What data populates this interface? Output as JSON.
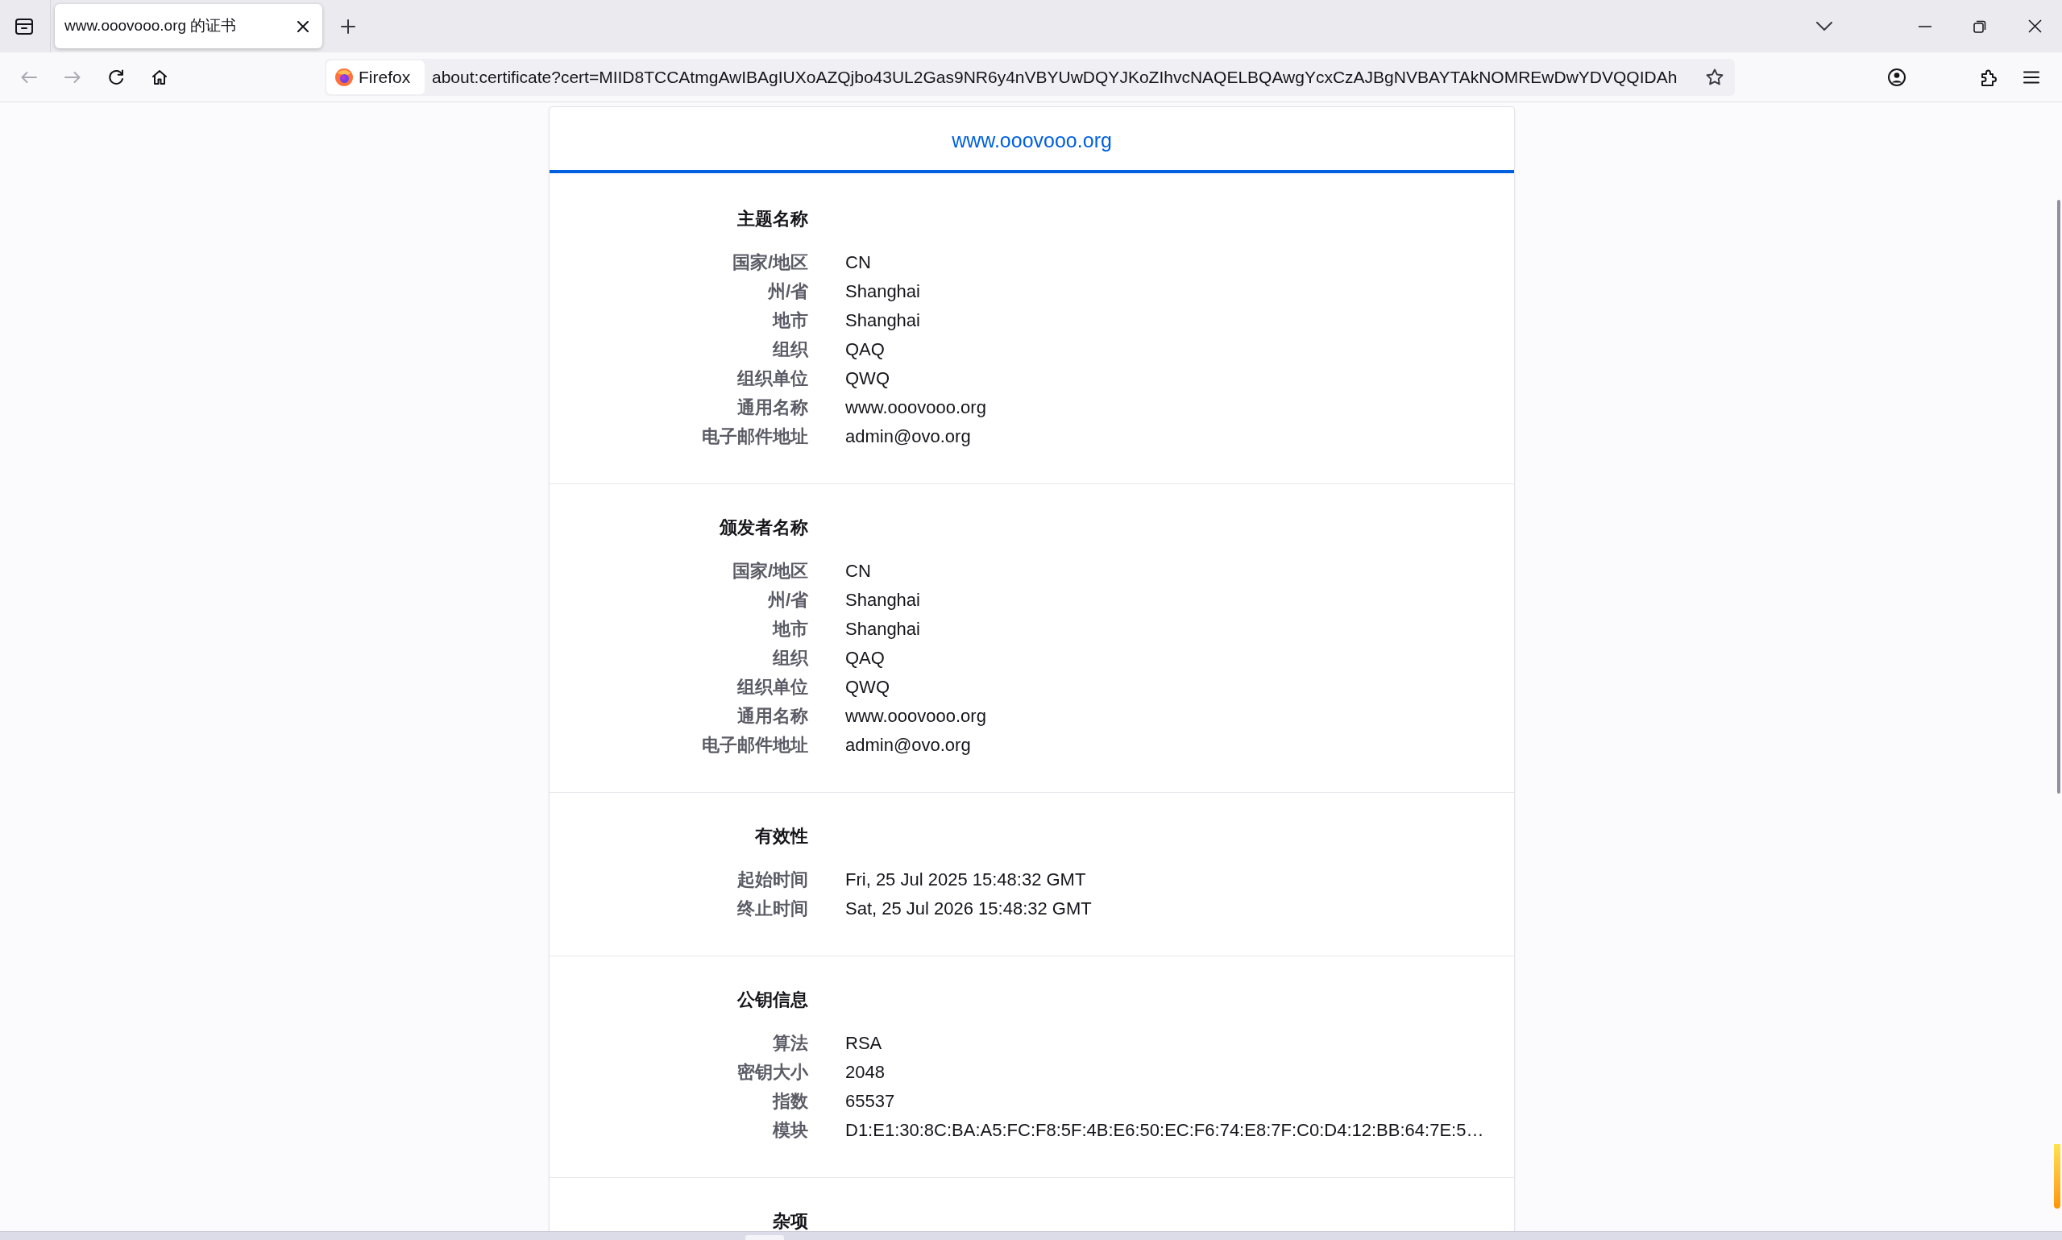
{
  "browser": {
    "tabs": [
      {
        "title": "www.ooovooo.org 的证书",
        "selected": true
      }
    ],
    "navigation": {
      "back": {
        "disabled": true
      },
      "forward": {
        "disabled": true
      }
    },
    "identity_label": "Firefox",
    "address": "about:certificate?cert=MIID8TCCAtmgAwIBAgIUXoAZQjbo43UL2Gas9NR6y4nVBYUwDQYJKoZIhvcNAQELBQAwgYcxCzAJBgNVBAYTAkNOMREwDwYDVQQIDAh"
  },
  "certificate_tabs": [
    {
      "label": "www.ooovooo.org",
      "selected": true
    }
  ],
  "sections": [
    {
      "title": "主题名称",
      "fields": [
        {
          "label": "国家/地区",
          "value": "CN"
        },
        {
          "label": "州/省",
          "value": "Shanghai"
        },
        {
          "label": "地市",
          "value": "Shanghai"
        },
        {
          "label": "组织",
          "value": "QAQ"
        },
        {
          "label": "组织单位",
          "value": "QWQ"
        },
        {
          "label": "通用名称",
          "value": "www.ooovooo.org"
        },
        {
          "label": "电子邮件地址",
          "value": "admin@ovo.org"
        }
      ]
    },
    {
      "title": "颁发者名称",
      "fields": [
        {
          "label": "国家/地区",
          "value": "CN"
        },
        {
          "label": "州/省",
          "value": "Shanghai"
        },
        {
          "label": "地市",
          "value": "Shanghai"
        },
        {
          "label": "组织",
          "value": "QAQ"
        },
        {
          "label": "组织单位",
          "value": "QWQ"
        },
        {
          "label": "通用名称",
          "value": "www.ooovooo.org"
        },
        {
          "label": "电子邮件地址",
          "value": "admin@ovo.org"
        }
      ]
    },
    {
      "title": "有效性",
      "fields": [
        {
          "label": "起始时间",
          "value": "Fri, 25 Jul 2025 15:48:32 GMT"
        },
        {
          "label": "终止时间",
          "value": "Sat, 25 Jul 2026 15:48:32 GMT"
        }
      ]
    },
    {
      "title": "公钥信息",
      "fields": [
        {
          "label": "算法",
          "value": "RSA"
        },
        {
          "label": "密钥大小",
          "value": "2048"
        },
        {
          "label": "指数",
          "value": "65537"
        },
        {
          "label": "模块",
          "value": "D1:E1:30:8C:BA:A5:FC:F8:5F:4B:E6:50:EC:F6:74:E8:7F:C0:D4:12:BB:64:7E:5…"
        }
      ]
    },
    {
      "title": "杂项"
    }
  ]
}
